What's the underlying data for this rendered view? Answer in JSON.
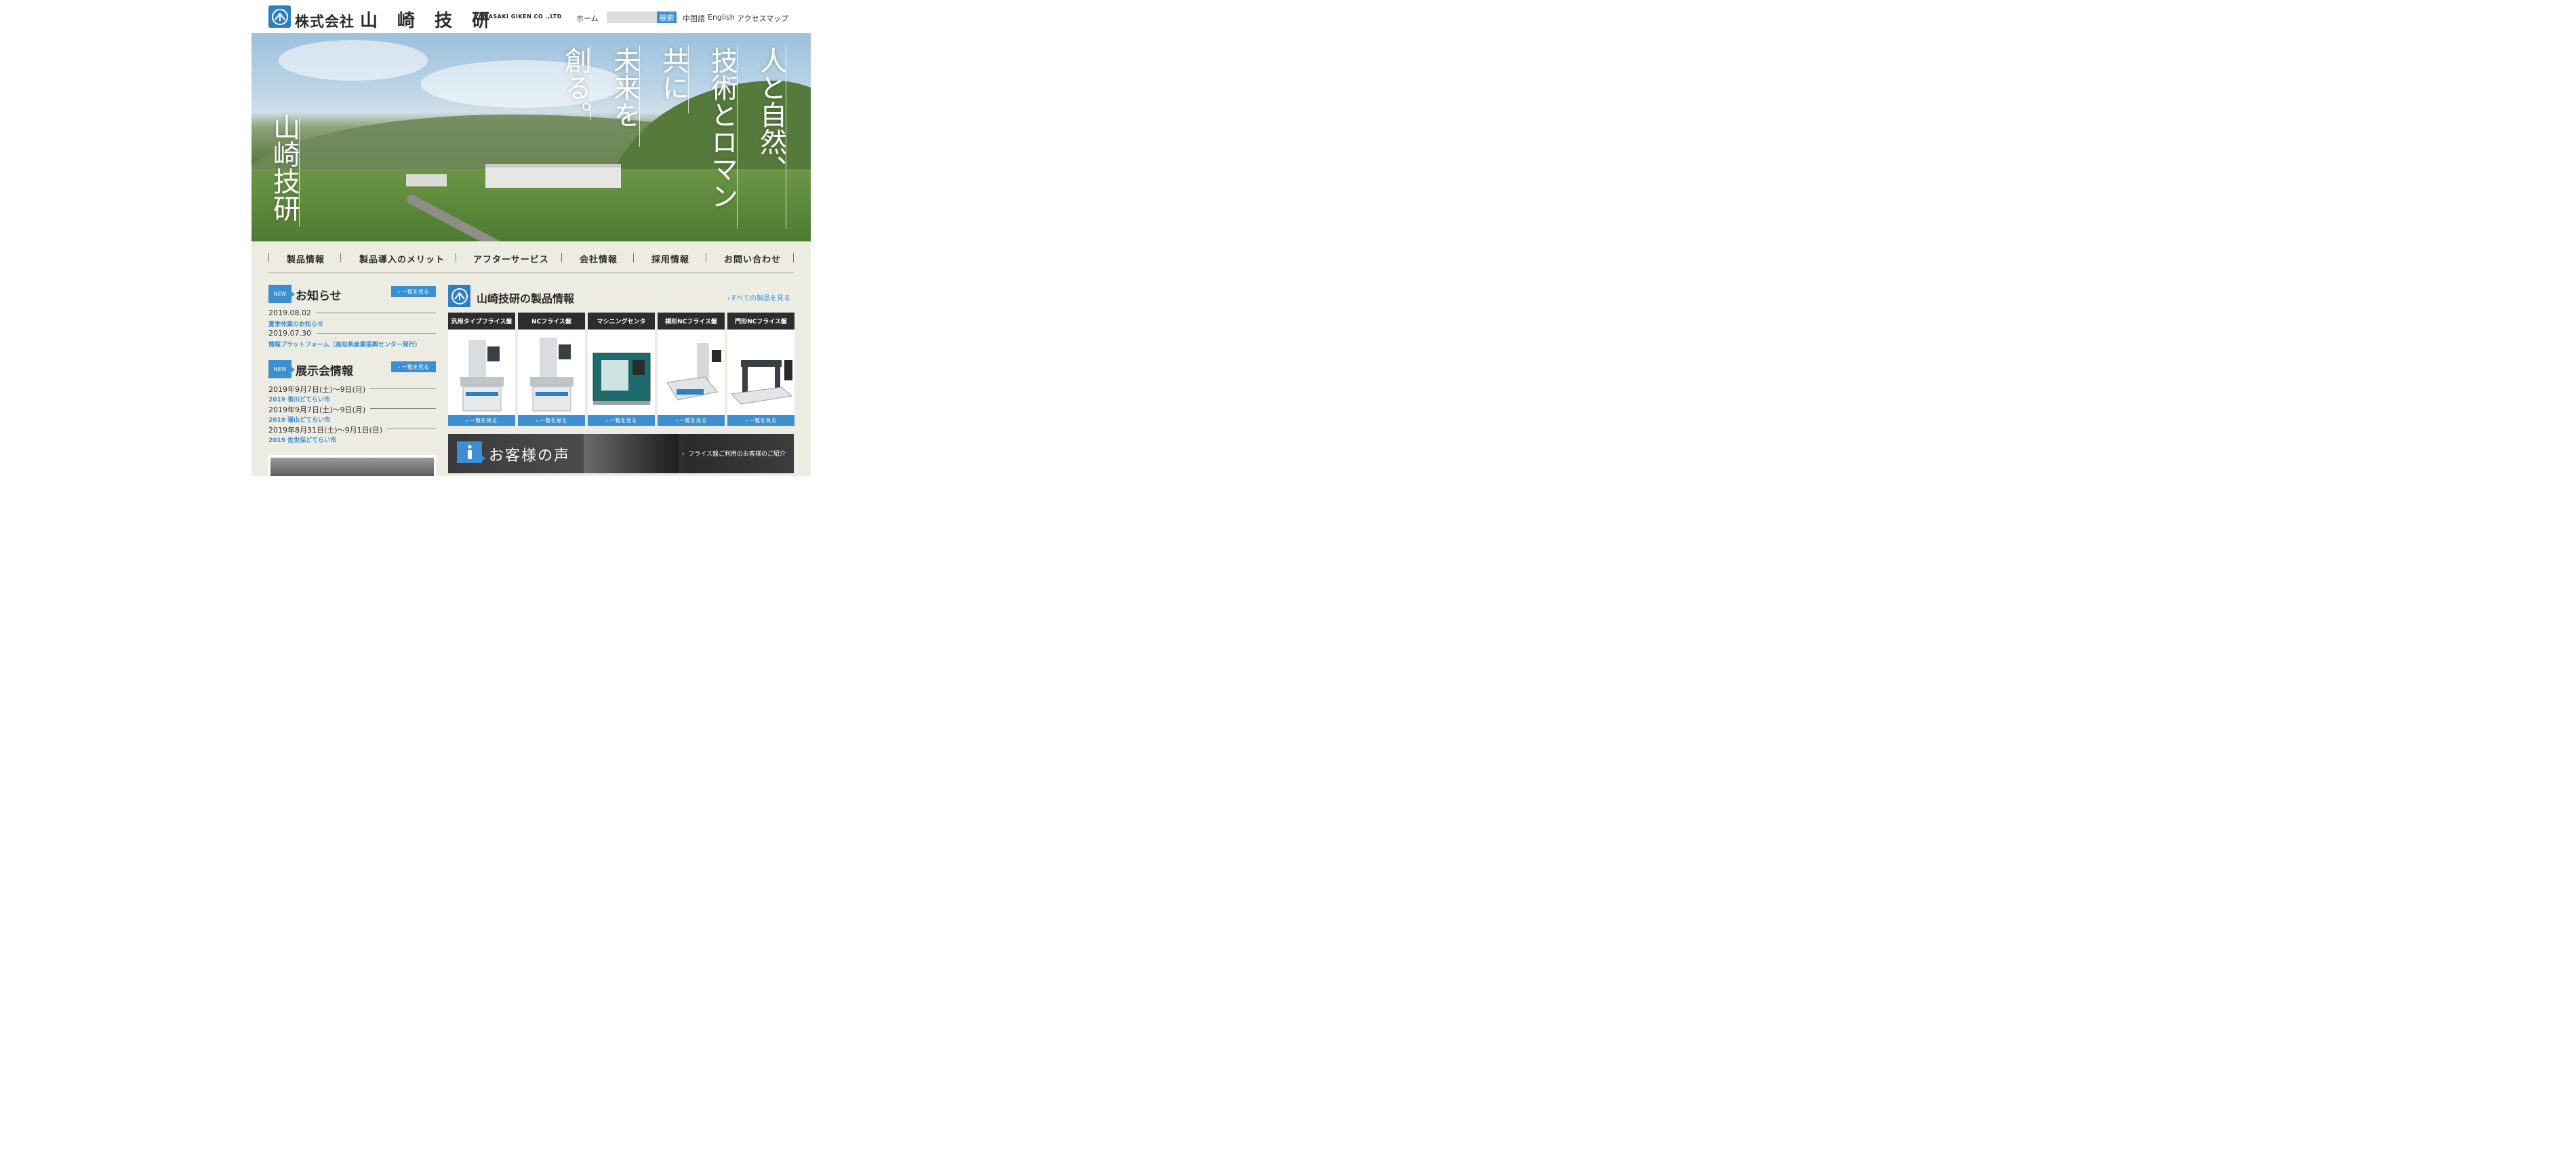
{
  "header": {
    "logo_text": "株式会社",
    "logo_name": "山 崎 技 研",
    "logo_sub": "YAMASAKI GIKEN CO .,LTD",
    "nav_home": "ホーム",
    "search_placeholder": "",
    "search_button": "検索",
    "lang_chinese": "中国語",
    "lang_english": "English",
    "access_map": "アクセスマップ"
  },
  "hero": {
    "col1": "人と自然、",
    "col2": "技術とロマン",
    "col3": "共に",
    "col4": "未来を",
    "col5": "創る。",
    "left": "山崎技研"
  },
  "global_nav": [
    "製品情報",
    "製品導入のメリット",
    "アフターサービス",
    "会社情報",
    "採用情報",
    "お問い合わせ"
  ],
  "news": {
    "badge": "NEW",
    "title": "お知らせ",
    "more": "一覧を見る",
    "items": [
      {
        "date": "2019.08.02",
        "title": "夏季休業のお知らせ"
      },
      {
        "date": "2019.07.30",
        "title": "情報プラットフォーム（高知県産業振興センター発行）"
      }
    ]
  },
  "exhibition": {
    "badge": "NEW",
    "title": "展示会情報",
    "more": "一覧を見る",
    "items": [
      {
        "date": "2019年9月7日(土)〜9日(月)",
        "title": "2019 香川どてらい市"
      },
      {
        "date": "2019年9月7日(土)〜9日(月)",
        "title": "2019 福山どてらい市"
      },
      {
        "date": "2019年8月31日(土)〜9月1日(日)",
        "title": "2019 佐世保どてらい市"
      }
    ]
  },
  "products": {
    "title": "山崎技研の製品情報",
    "all_link": "すべての製品を見る",
    "more": "一覧を見る",
    "cards": [
      "汎用タイプフライス盤",
      "NCフライス盤",
      "マシニングセンタ",
      "横形NCフライス盤",
      "門形NCフライス盤"
    ]
  },
  "voice": {
    "title": "お客様の声",
    "subtitle": "フライス盤ご利用のお客様のご紹介"
  },
  "colors": {
    "accent": "#3c8fd1",
    "band": "#edece3",
    "card_title": "#2d2d2d"
  }
}
